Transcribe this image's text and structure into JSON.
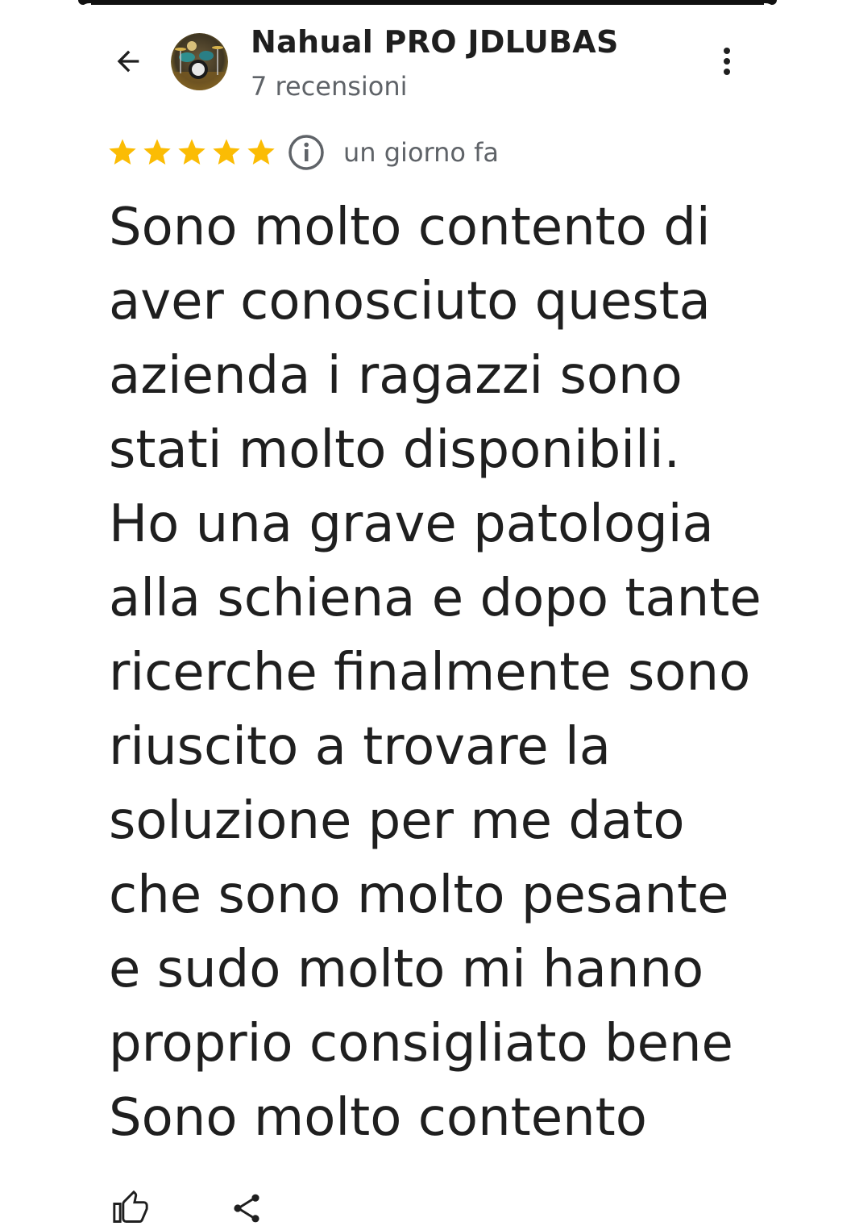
{
  "header": {
    "back_icon": "arrow-back-icon",
    "reviewer_name": "Nahual PRO JDLUBAS",
    "review_count": "7 recensioni",
    "menu_icon": "more-vert-icon"
  },
  "review": {
    "rating": 5,
    "rating_max": 5,
    "star_color": "#fbbc04",
    "info_icon": "info-icon",
    "date": "un giorno fa",
    "text_lines": [
      "Sono molto contento di",
      "aver conosciuto questa",
      "azienda i ragazzi sono",
      "stati molto disponibili.",
      "Ho una grave patologia",
      "alla schiena e dopo tante",
      "ricerche finalmente sono",
      "riuscito a trovare la",
      "soluzione per me dato",
      "che sono molto pesante",
      "e sudo molto mi hanno",
      "proprio consigliato bene",
      "Sono molto contento"
    ]
  },
  "actions": {
    "like_icon": "thumb-up-icon",
    "share_icon": "share-icon"
  }
}
